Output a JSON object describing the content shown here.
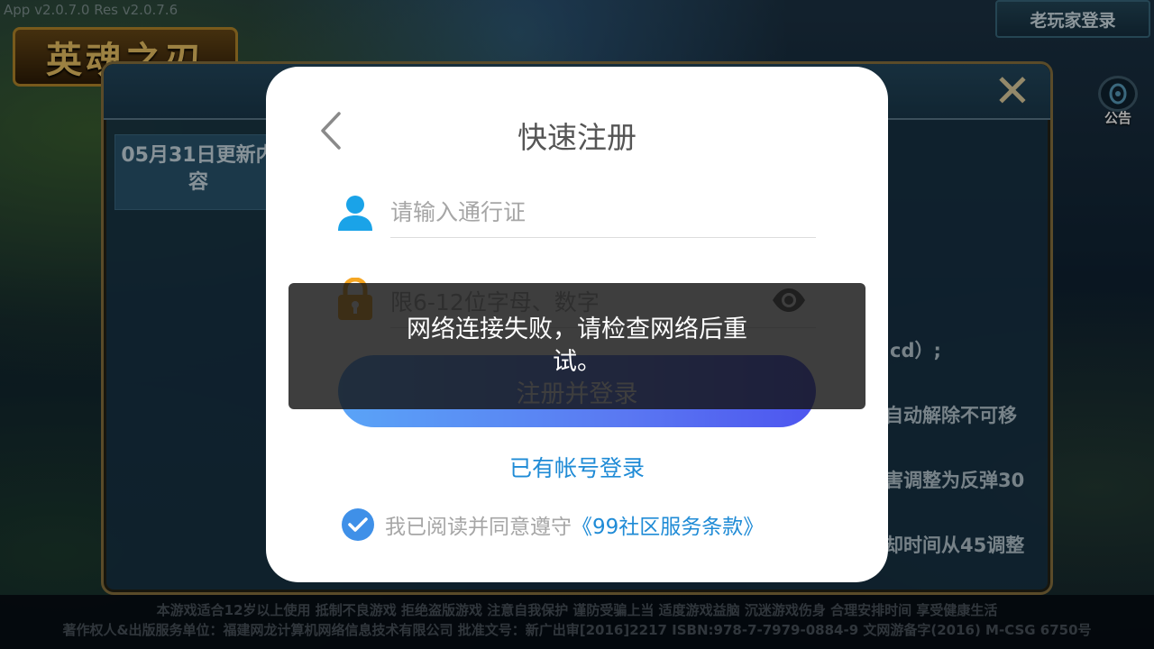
{
  "app": {
    "version_text": "App v2.0.7.0   Res v2.0.7.6",
    "logo_text": "英魂之刃",
    "old_player_login": "老玩家登录",
    "notice_label": "公告"
  },
  "panel": {
    "tab_label": "05月31日更新内容",
    "text_lines": [
      "cd）;",
      "自动解除不可移",
      "害调整为反弹30",
      "却时间从45调整"
    ]
  },
  "footer": {
    "line1": "本游戏适合12岁以上使用 抵制不良游戏 拒绝盗版游戏 注意自我保护 谨防受骗上当 适度游戏益脑 沉迷游戏伤身 合理安排时间 享受健康生活",
    "line2": "著作权人&出版服务单位：福建网龙计算机网络信息技术有限公司 批准文号：新广出审[2016]2217 ISBN:978-7-7979-0884-9 文网游备字(2016) M-CSG 6750号"
  },
  "modal": {
    "title": "快速注册",
    "username_placeholder": "请输入通行证",
    "password_placeholder": "限6-12位字母、数字",
    "submit_label": "注册并登录",
    "have_account_label": "已有帐号登录",
    "agree_text": "我已阅读并同意遵守",
    "terms_link": "《99社区服务条款》",
    "agree_checked": true
  },
  "toast": {
    "message": "网络连接失败，请检查网络后重试。"
  },
  "colors": {
    "accent_blue": "#1f8bd6",
    "button_gradient_start": "#5aa4f7",
    "button_gradient_end": "#4d55ef",
    "lock_icon": "#f5a623",
    "user_icon": "#1aa3e8"
  },
  "icons": {
    "back": "back-chevron-icon",
    "user": "user-icon",
    "lock": "lock-icon",
    "eye": "eye-icon",
    "check": "check-icon",
    "close": "close-icon",
    "notice": "notice-icon"
  }
}
